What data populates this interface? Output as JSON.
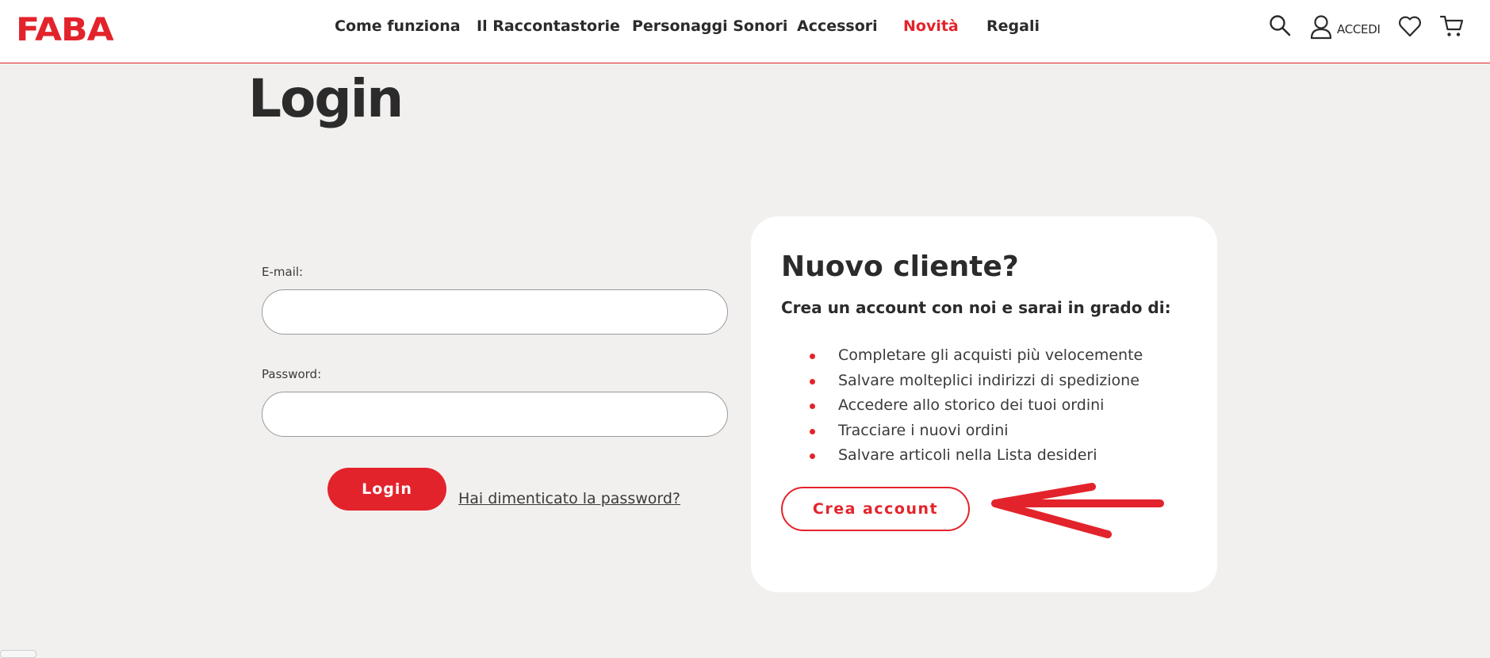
{
  "header": {
    "logo": "FABA",
    "nav": [
      {
        "label": "Come funziona",
        "name": "nav-come-funziona"
      },
      {
        "label": "Il Raccontastorie",
        "name": "nav-il-raccontastorie"
      },
      {
        "label": "Personaggi Sonori",
        "name": "nav-personaggi-sonori"
      },
      {
        "label": "Accessori",
        "name": "nav-accessori"
      },
      {
        "label": "Novità",
        "name": "nav-novita",
        "active": true
      },
      {
        "label": "Regali",
        "name": "nav-regali"
      }
    ],
    "accedi_label": "ACCEDI",
    "icons": [
      "search-icon",
      "user-icon",
      "heart-icon",
      "cart-icon"
    ]
  },
  "page": {
    "title": "Login"
  },
  "login_form": {
    "email_label": "E-mail:",
    "email_value": "",
    "password_label": "Password:",
    "password_value": "",
    "login_button": "Login",
    "forgot_link": "Hai dimenticato la password?"
  },
  "new_customer": {
    "title": "Nuovo cliente?",
    "subtitle": "Crea un account con noi e sarai in grado di:",
    "benefits": [
      "Completare gli acquisti più velocemente",
      "Salvare molteplici indirizzi di spedizione",
      "Accedere allo storico dei tuoi ordini",
      "Tracciare i nuovi ordini",
      "Salvare articoli nella Lista desideri"
    ],
    "create_button": "Crea account"
  },
  "colors": {
    "brand_red": "#e3232b",
    "background": "#f2f0ee",
    "text": "#2b2b2b",
    "card": "#ffffff"
  }
}
